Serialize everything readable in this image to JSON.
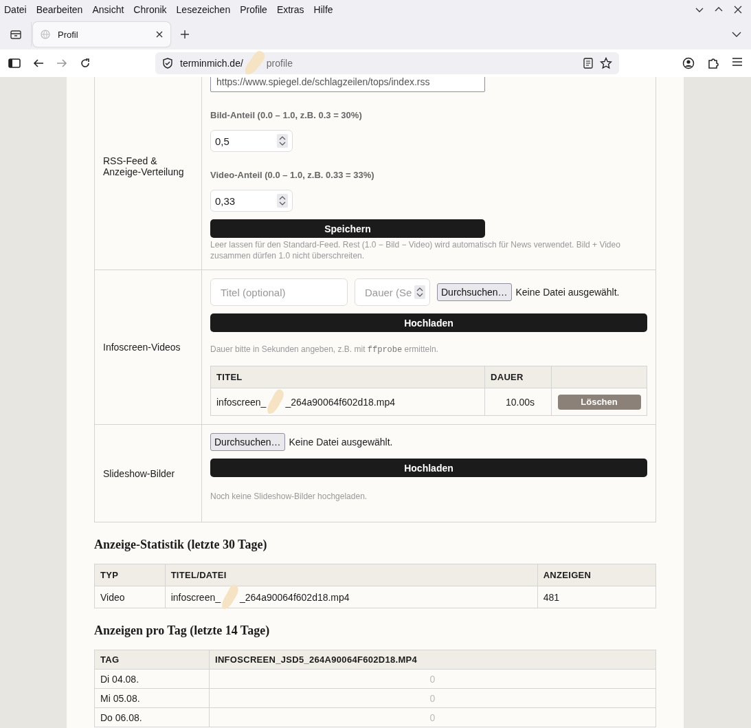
{
  "menu": [
    "Datei",
    "Bearbeiten",
    "Ansicht",
    "Chronik",
    "Lesezeichen",
    "Profile",
    "Extras",
    "Hilfe"
  ],
  "tabs": [
    {
      "title": "Profil",
      "selected": true
    }
  ],
  "address": {
    "host": "terminmich.de/",
    "path": "profile"
  },
  "settings": [
    {
      "kind": "rss",
      "label": "RSS-Feed & Anzeige-Verteilung",
      "feed_value": "https://www.spiegel.de/schlagzeilen/tops/index.rss",
      "fields": [
        {
          "label": "Bild-Anteil (0.0 – 1.0, z.B. 0.3 = 30%)",
          "value": "0,5"
        },
        {
          "label": "Video-Anteil (0.0 – 1.0, z.B. 0.33 = 33%)",
          "value": "0,33"
        }
      ],
      "button": "Speichern",
      "hint": "Leer lassen für den Standard-Feed. Rest (1.0 − Bild − Video) wird automatisch für News verwendet. Bild + Video zusammen dürfen 1.0 nicht überschreiten."
    },
    {
      "kind": "videos",
      "label": "Infoscreen-Videos",
      "title_placeholder": "Titel (optional)",
      "duration_placeholder": "Dauer (Se",
      "browse": "Durchsuchen…",
      "no_file": "Keine Datei ausgewählt.",
      "button": "Hochladen",
      "hint_before": "Dauer bitte in Sekunden angeben, z.B. mit",
      "hint_code": "ffprobe",
      "hint_after": "ermitteln.",
      "columns": [
        "TITEL",
        "DAUER"
      ],
      "rows": [
        {
          "title_before": "infoscreen_",
          "title_after": "_264a90064f602d18.mp4",
          "duration": "10.00s",
          "action": "Löschen"
        }
      ]
    },
    {
      "kind": "images",
      "label": "Slideshow-Bilder",
      "browse": "Durchsuchen…",
      "no_file": "Keine Datei ausgewählt.",
      "button": "Hochladen",
      "hint": "Noch keine Slideshow-Bilder hochgeladen."
    }
  ],
  "stats": {
    "heading": "Anzeige-Statistik (letzte 30 Tage)",
    "columns": [
      "TYP",
      "TITEL/DATEI",
      "ANZEIGEN"
    ],
    "rows": [
      {
        "type": "Video",
        "file_before": "infoscreen_",
        "file_after": "_264a90064f602d18.mp4",
        "count": "481"
      }
    ]
  },
  "daily": {
    "heading": "Anzeigen pro Tag (letzte 14 Tage)",
    "columns": [
      "TAG",
      "INFOSCREEN_JSD5_264A90064F602D18.MP4"
    ],
    "rows": [
      {
        "day": "Di 04.08.",
        "value": "0"
      },
      {
        "day": "Mi 05.08.",
        "value": "0"
      },
      {
        "day": "Do 06.08.",
        "value": "0"
      }
    ]
  }
}
